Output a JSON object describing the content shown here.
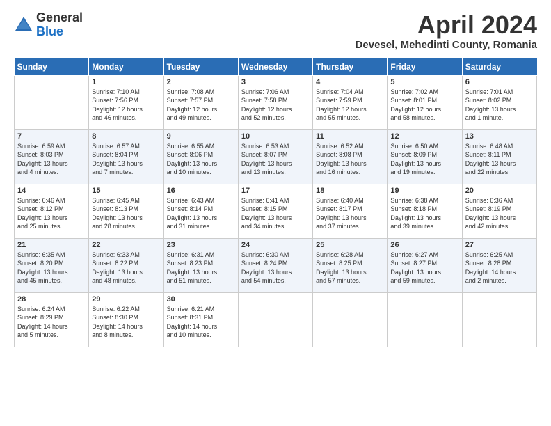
{
  "header": {
    "logo_general": "General",
    "logo_blue": "Blue",
    "month_title": "April 2024",
    "location": "Devesel, Mehedinti County, Romania"
  },
  "weekdays": [
    "Sunday",
    "Monday",
    "Tuesday",
    "Wednesday",
    "Thursday",
    "Friday",
    "Saturday"
  ],
  "weeks": [
    [
      {
        "day": "",
        "info": ""
      },
      {
        "day": "1",
        "info": "Sunrise: 7:10 AM\nSunset: 7:56 PM\nDaylight: 12 hours\nand 46 minutes."
      },
      {
        "day": "2",
        "info": "Sunrise: 7:08 AM\nSunset: 7:57 PM\nDaylight: 12 hours\nand 49 minutes."
      },
      {
        "day": "3",
        "info": "Sunrise: 7:06 AM\nSunset: 7:58 PM\nDaylight: 12 hours\nand 52 minutes."
      },
      {
        "day": "4",
        "info": "Sunrise: 7:04 AM\nSunset: 7:59 PM\nDaylight: 12 hours\nand 55 minutes."
      },
      {
        "day": "5",
        "info": "Sunrise: 7:02 AM\nSunset: 8:01 PM\nDaylight: 12 hours\nand 58 minutes."
      },
      {
        "day": "6",
        "info": "Sunrise: 7:01 AM\nSunset: 8:02 PM\nDaylight: 13 hours\nand 1 minute."
      }
    ],
    [
      {
        "day": "7",
        "info": "Sunrise: 6:59 AM\nSunset: 8:03 PM\nDaylight: 13 hours\nand 4 minutes."
      },
      {
        "day": "8",
        "info": "Sunrise: 6:57 AM\nSunset: 8:04 PM\nDaylight: 13 hours\nand 7 minutes."
      },
      {
        "day": "9",
        "info": "Sunrise: 6:55 AM\nSunset: 8:06 PM\nDaylight: 13 hours\nand 10 minutes."
      },
      {
        "day": "10",
        "info": "Sunrise: 6:53 AM\nSunset: 8:07 PM\nDaylight: 13 hours\nand 13 minutes."
      },
      {
        "day": "11",
        "info": "Sunrise: 6:52 AM\nSunset: 8:08 PM\nDaylight: 13 hours\nand 16 minutes."
      },
      {
        "day": "12",
        "info": "Sunrise: 6:50 AM\nSunset: 8:09 PM\nDaylight: 13 hours\nand 19 minutes."
      },
      {
        "day": "13",
        "info": "Sunrise: 6:48 AM\nSunset: 8:11 PM\nDaylight: 13 hours\nand 22 minutes."
      }
    ],
    [
      {
        "day": "14",
        "info": "Sunrise: 6:46 AM\nSunset: 8:12 PM\nDaylight: 13 hours\nand 25 minutes."
      },
      {
        "day": "15",
        "info": "Sunrise: 6:45 AM\nSunset: 8:13 PM\nDaylight: 13 hours\nand 28 minutes."
      },
      {
        "day": "16",
        "info": "Sunrise: 6:43 AM\nSunset: 8:14 PM\nDaylight: 13 hours\nand 31 minutes."
      },
      {
        "day": "17",
        "info": "Sunrise: 6:41 AM\nSunset: 8:15 PM\nDaylight: 13 hours\nand 34 minutes."
      },
      {
        "day": "18",
        "info": "Sunrise: 6:40 AM\nSunset: 8:17 PM\nDaylight: 13 hours\nand 37 minutes."
      },
      {
        "day": "19",
        "info": "Sunrise: 6:38 AM\nSunset: 8:18 PM\nDaylight: 13 hours\nand 39 minutes."
      },
      {
        "day": "20",
        "info": "Sunrise: 6:36 AM\nSunset: 8:19 PM\nDaylight: 13 hours\nand 42 minutes."
      }
    ],
    [
      {
        "day": "21",
        "info": "Sunrise: 6:35 AM\nSunset: 8:20 PM\nDaylight: 13 hours\nand 45 minutes."
      },
      {
        "day": "22",
        "info": "Sunrise: 6:33 AM\nSunset: 8:22 PM\nDaylight: 13 hours\nand 48 minutes."
      },
      {
        "day": "23",
        "info": "Sunrise: 6:31 AM\nSunset: 8:23 PM\nDaylight: 13 hours\nand 51 minutes."
      },
      {
        "day": "24",
        "info": "Sunrise: 6:30 AM\nSunset: 8:24 PM\nDaylight: 13 hours\nand 54 minutes."
      },
      {
        "day": "25",
        "info": "Sunrise: 6:28 AM\nSunset: 8:25 PM\nDaylight: 13 hours\nand 57 minutes."
      },
      {
        "day": "26",
        "info": "Sunrise: 6:27 AM\nSunset: 8:27 PM\nDaylight: 13 hours\nand 59 minutes."
      },
      {
        "day": "27",
        "info": "Sunrise: 6:25 AM\nSunset: 8:28 PM\nDaylight: 14 hours\nand 2 minutes."
      }
    ],
    [
      {
        "day": "28",
        "info": "Sunrise: 6:24 AM\nSunset: 8:29 PM\nDaylight: 14 hours\nand 5 minutes."
      },
      {
        "day": "29",
        "info": "Sunrise: 6:22 AM\nSunset: 8:30 PM\nDaylight: 14 hours\nand 8 minutes."
      },
      {
        "day": "30",
        "info": "Sunrise: 6:21 AM\nSunset: 8:31 PM\nDaylight: 14 hours\nand 10 minutes."
      },
      {
        "day": "",
        "info": ""
      },
      {
        "day": "",
        "info": ""
      },
      {
        "day": "",
        "info": ""
      },
      {
        "day": "",
        "info": ""
      }
    ]
  ]
}
